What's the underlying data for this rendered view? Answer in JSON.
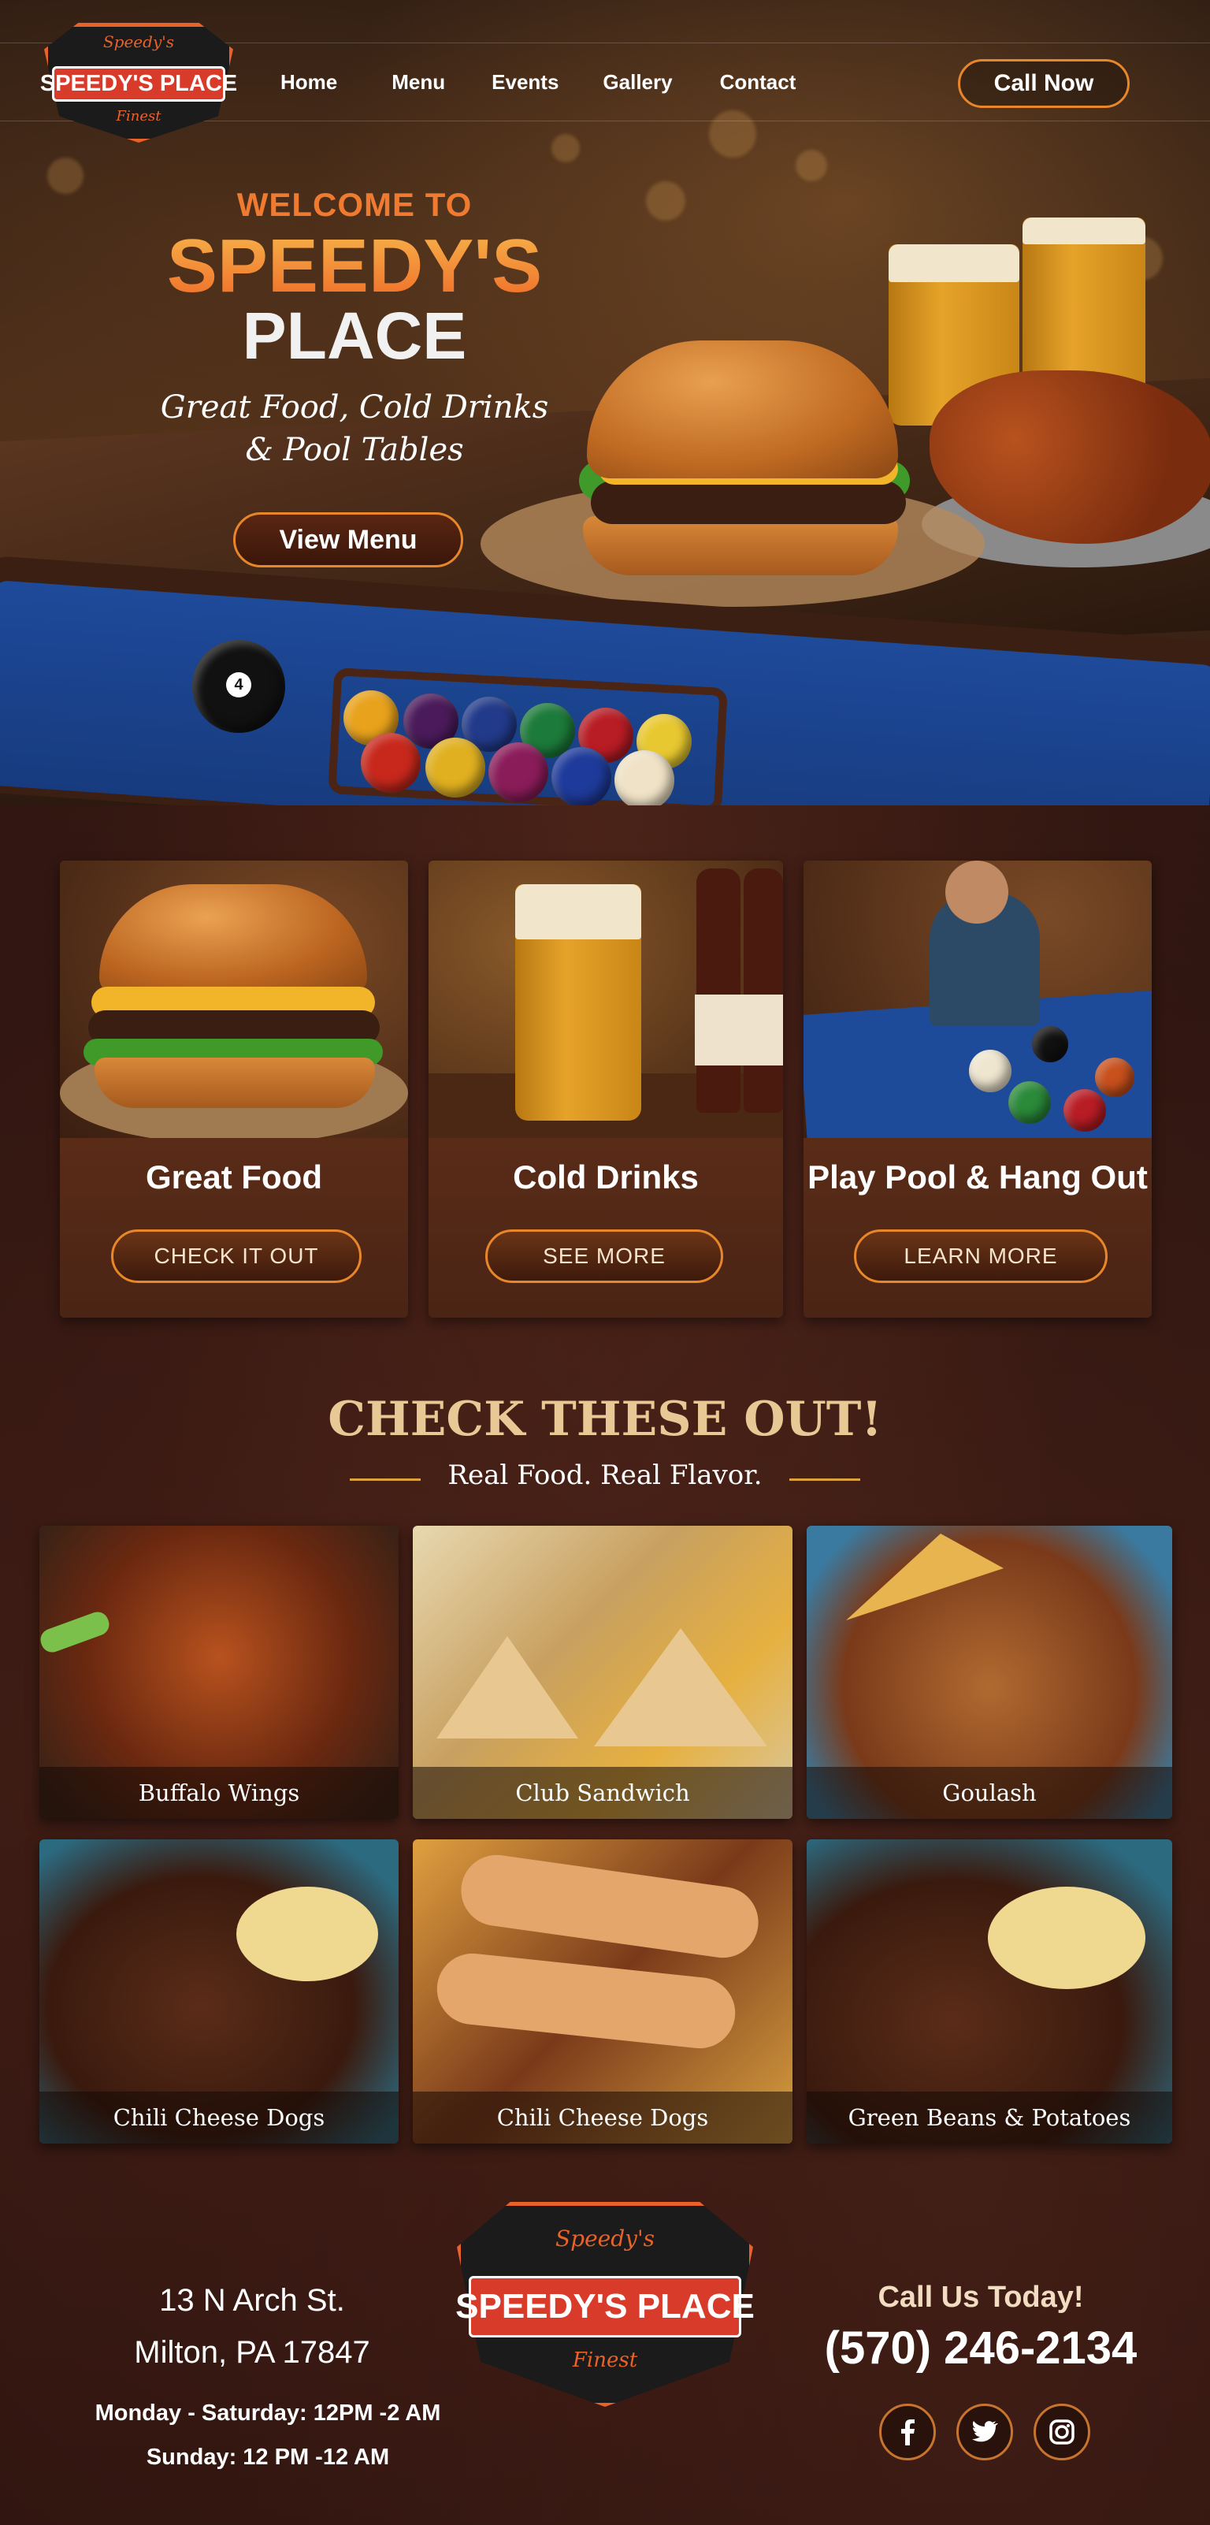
{
  "brand": {
    "logo_top_script": "Speedy's",
    "logo_name": "SPEEDY'S PLACE",
    "logo_bottom_script": "Finest"
  },
  "nav": {
    "items": [
      "Home",
      "Menu",
      "Events",
      "Gallery",
      "Contact"
    ],
    "call_label": "Call Now"
  },
  "hero": {
    "welcome": "WELCOME TO",
    "title_line1": "SPEEDY'S",
    "title_line2": "PLACE",
    "tagline_line1": "Great Food, Cold Drinks",
    "tagline_line2": "& Pool Tables",
    "button": "View Menu",
    "ball_number": "4"
  },
  "features": [
    {
      "label": "Great Food",
      "button": "CHECK IT OUT"
    },
    {
      "label": "Cold Drinks",
      "button": "SEE MORE"
    },
    {
      "label": "Play Pool & Hang Out",
      "button": "LEARN MORE"
    }
  ],
  "specials": {
    "title": "CHECK THESE OUT!",
    "subtitle": "Real Food. Real Flavor.",
    "items": [
      "Buffalo Wings",
      "Club Sandwich",
      "Goulash",
      "Chili Cheese Dogs",
      "Chili Cheese Dogs",
      "Green Beans & Potatoes"
    ]
  },
  "footer": {
    "address_line1": "13 N Arch St.",
    "address_line2": "Milton, PA 17847",
    "hours_line1": "Monday - Saturday: 12PM -2 AM",
    "hours_line2": "Sunday:  12 PM -12 AM",
    "call_today": "Call Us Today!",
    "phone": "(570) 246-2134",
    "social": [
      "facebook-icon",
      "twitter-icon",
      "instagram-icon"
    ]
  },
  "colors": {
    "accent": "#e8862a",
    "title_orange": "#ef7a30",
    "heading_gold": "#e8c894",
    "felt_blue": "#1e4a9a"
  }
}
